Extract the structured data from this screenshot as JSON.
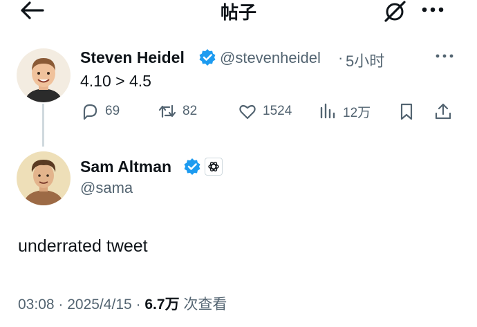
{
  "header": {
    "title": "帖子",
    "back_icon": "arrow-left-icon",
    "grok_icon": "grok-icon",
    "more_icon": "ellipsis-icon"
  },
  "parent_tweet": {
    "name": "Steven Heidel",
    "handle": "@stevenheidel",
    "separator": "·",
    "time": "5小时",
    "text": "4.10 > 4.5",
    "replies": "69",
    "retweets": "82",
    "likes": "1524",
    "views": "12万"
  },
  "main_tweet": {
    "name": "Sam Altman",
    "handle": "@sama",
    "text": "underrated tweet",
    "time": "03:08",
    "sep1": "·",
    "date": "2025/4/15",
    "sep2": "·",
    "views": "6.7万",
    "views_label": " 次查看"
  },
  "colors": {
    "verified": "#1d9bf0",
    "secondary_text": "#536471",
    "primary_text": "#0f1419"
  }
}
